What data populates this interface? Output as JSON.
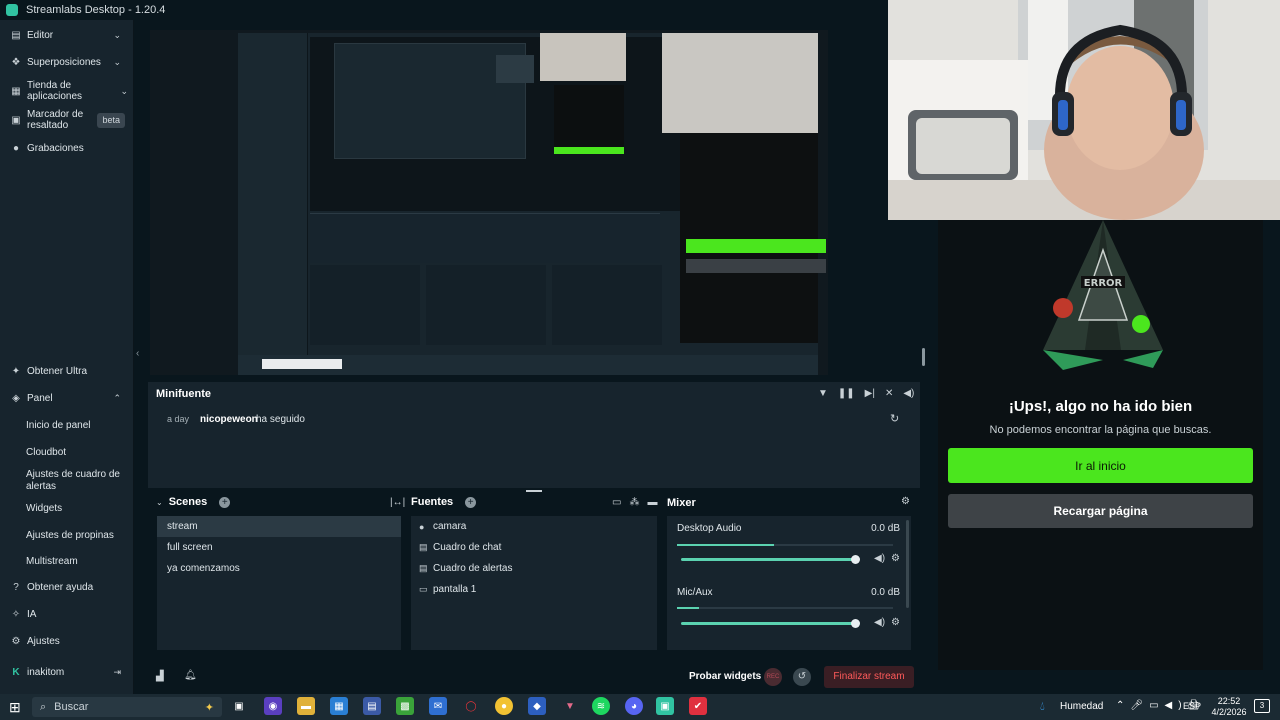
{
  "window": {
    "title": "Streamlabs Desktop - 1.20.4"
  },
  "sidebar": {
    "top_items": [
      {
        "label": "Editor",
        "icon": "layout-icon"
      },
      {
        "label": "Superposiciones",
        "icon": "layers-icon"
      },
      {
        "label": "Tienda de aplicaciones",
        "icon": "store-icon"
      },
      {
        "label": "Marcador de resaltado",
        "icon": "highlight-icon",
        "badge": "beta"
      },
      {
        "label": "Grabaciones",
        "icon": "record-icon"
      }
    ],
    "bottom_items": {
      "obtener_ultra": "Obtener Ultra",
      "panel": "Panel",
      "panel_sub": [
        "Inicio de panel",
        "Cloudbot",
        "Ajustes de cuadro de alertas",
        "Widgets",
        "Ajustes de propinas",
        "Multistream"
      ],
      "obtener_ayuda": "Obtener ayuda",
      "ia": "IA",
      "ajustes": "Ajustes",
      "user": "inakitom"
    }
  },
  "minifeed": {
    "title": "Minifuente",
    "event": {
      "time": "a day",
      "user": "nicopeweon",
      "action": "ha seguido"
    }
  },
  "scenes": {
    "title": "Scenes",
    "items": [
      "stream",
      "full screen",
      "ya comenzamos"
    ],
    "selected": 0
  },
  "sources": {
    "title": "Fuentes",
    "items": [
      {
        "label": "camara",
        "icon": "webcam-icon"
      },
      {
        "label": "Cuadro de chat",
        "icon": "chat-icon"
      },
      {
        "label": "Cuadro de alertas",
        "icon": "alert-icon"
      },
      {
        "label": "pantalla 1",
        "icon": "monitor-icon"
      }
    ]
  },
  "mixer": {
    "title": "Mixer",
    "channels": [
      {
        "name": "Desktop Audio",
        "db": "0.0 dB",
        "level": 0.45,
        "volume": 1.0
      },
      {
        "name": "Mic/Aux",
        "db": "0.0 dB",
        "level": 0.1,
        "volume": 1.0
      }
    ]
  },
  "footer": {
    "test_widgets": "Probar widgets",
    "rec": "REC",
    "end_stream": "Finalizar stream"
  },
  "browser_page": {
    "heading": "¡Ups!, algo no ha ido bien",
    "message": "No podemos encontrar la página que buscas.",
    "primary": "Ir al inicio",
    "secondary": "Recargar página"
  },
  "taskbar": {
    "search": "Buscar",
    "weather": "Humedad",
    "lang": "ESP",
    "time": "22:52",
    "date": "4/2/2026",
    "notifications": "3"
  },
  "colors": {
    "accent": "#31c3a2",
    "green": "#4be61e",
    "danger": "#ff5a5a"
  }
}
